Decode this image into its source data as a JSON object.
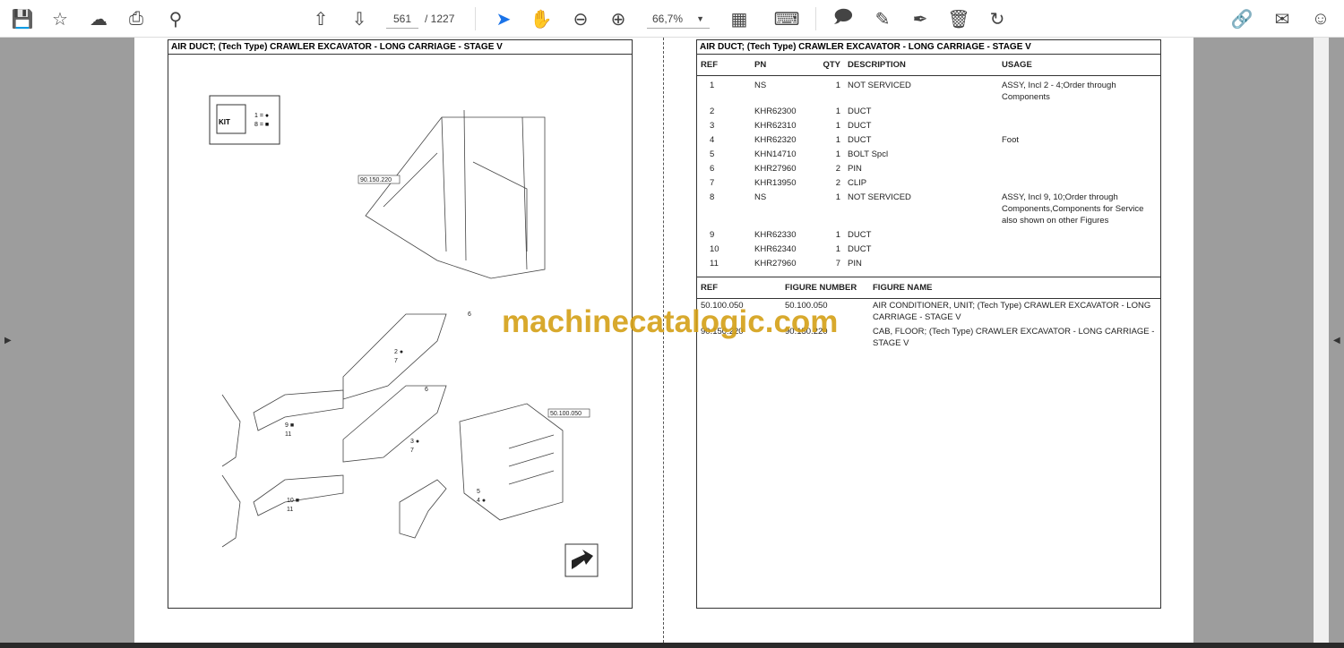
{
  "toolbar": {
    "page_current": "561",
    "page_total": "/  1227",
    "zoom": "66,7%"
  },
  "left_page": {
    "title": "AIR DUCT; (Tech Type) CRAWLER EXCAVATOR - LONG CARRIAGE - STAGE V",
    "kit_legend": [
      "1 = ●",
      "8 = ■"
    ],
    "callouts": {
      "ref1": "90.150.220",
      "ref2": "50.100.050",
      "c6a": "6",
      "c2": "2 ●",
      "c7a": "7",
      "c9": "9 ■",
      "c11a": "11",
      "c6b": "6",
      "c3": "3 ●",
      "c7b": "7",
      "c10": "10 ■",
      "c11b": "11",
      "c5": "5",
      "c4": "4 ●"
    }
  },
  "right_page": {
    "title": "AIR DUCT; (Tech Type) CRAWLER EXCAVATOR - LONG CARRIAGE - STAGE V",
    "parts_headers": {
      "ref": "REF",
      "pn": "PN",
      "qty": "QTY",
      "desc": "DESCRIPTION",
      "usage": "USAGE"
    },
    "parts": [
      {
        "ref": "1",
        "pn": "NS",
        "qty": "1",
        "desc": "NOT SERVICED",
        "usage": "ASSY, Incl 2 - 4;Order through Components"
      },
      {
        "ref": "2",
        "pn": "KHR62300",
        "qty": "1",
        "desc": "DUCT",
        "usage": ""
      },
      {
        "ref": "3",
        "pn": "KHR62310",
        "qty": "1",
        "desc": "DUCT",
        "usage": ""
      },
      {
        "ref": "4",
        "pn": "KHR62320",
        "qty": "1",
        "desc": "DUCT",
        "usage": "Foot"
      },
      {
        "ref": "5",
        "pn": "KHN14710",
        "qty": "1",
        "desc": "BOLT Spcl",
        "usage": ""
      },
      {
        "ref": "6",
        "pn": "KHR27960",
        "qty": "2",
        "desc": "PIN",
        "usage": ""
      },
      {
        "ref": "7",
        "pn": "KHR13950",
        "qty": "2",
        "desc": "CLIP",
        "usage": ""
      },
      {
        "ref": "8",
        "pn": "NS",
        "qty": "1",
        "desc": "NOT SERVICED",
        "usage": "ASSY, Incl 9, 10;Order through Components,Components for Service also shown on other Figures"
      },
      {
        "ref": "9",
        "pn": "KHR62330",
        "qty": "1",
        "desc": "DUCT",
        "usage": ""
      },
      {
        "ref": "10",
        "pn": "KHR62340",
        "qty": "1",
        "desc": "DUCT",
        "usage": ""
      },
      {
        "ref": "11",
        "pn": "KHR27960",
        "qty": "7",
        "desc": "PIN",
        "usage": ""
      }
    ],
    "fig_headers": {
      "ref": "REF",
      "num": "FIGURE NUMBER",
      "name": "FIGURE NAME"
    },
    "figures": [
      {
        "ref": "50.100.050",
        "num": "50.100.050",
        "name": "AIR CONDITIONER, UNIT; (Tech Type) CRAWLER EXCAVATOR - LONG CARRIAGE - STAGE V"
      },
      {
        "ref": "90.150.220",
        "num": "90.150.220",
        "name": "CAB, FLOOR; (Tech Type) CRAWLER EXCAVATOR - LONG CARRIAGE - STAGE V"
      }
    ]
  },
  "watermark": "machinecatalogic.com"
}
